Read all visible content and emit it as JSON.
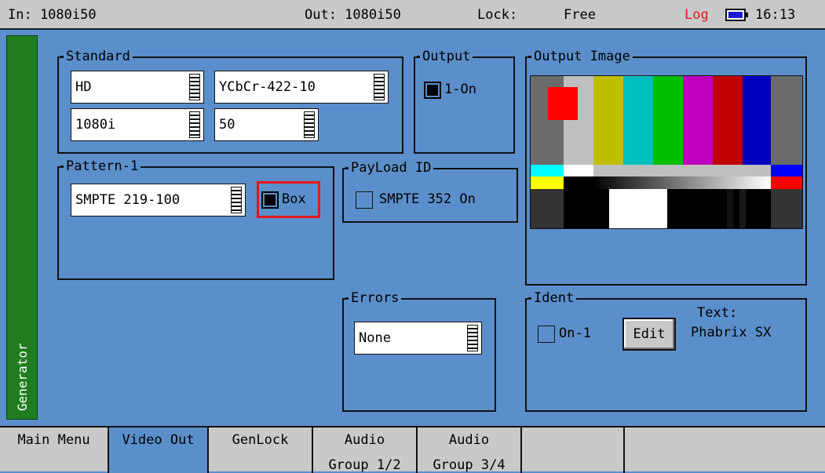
{
  "status": {
    "input": "In: 1080i50",
    "output": "Out: 1080i50",
    "lock_label": "Lock:",
    "lock_value": "Free",
    "log": "Log",
    "time": "16:13"
  },
  "side_label": "Generator",
  "standard": {
    "title": "Standard",
    "fields": [
      "HD",
      "YCbCr-422-10",
      "1080i",
      "50"
    ]
  },
  "output": {
    "title": "Output",
    "checkbox_label": "1-On",
    "checked": true
  },
  "output_image": {
    "title": "Output Image"
  },
  "pattern": {
    "title": "Pattern-1",
    "value": "SMPTE 219-100",
    "box_label": "Box",
    "box_checked": true
  },
  "payload": {
    "title": "PayLoad ID",
    "checkbox_label": "SMPTE 352 On",
    "checked": false
  },
  "errors": {
    "title": "Errors",
    "value": "None"
  },
  "ident": {
    "title": "Ident",
    "checkbox_label": "On-1",
    "checked": false,
    "edit_label": "Edit",
    "text_label": "Text:",
    "text_value": "Phabrix SX"
  },
  "tabs": [
    {
      "l1": "Main Menu",
      "l2": ""
    },
    {
      "l1": "Video Out",
      "l2": ""
    },
    {
      "l1": "GenLock",
      "l2": ""
    },
    {
      "l1": "Audio",
      "l2": "Group 1/2"
    },
    {
      "l1": "Audio",
      "l2": "Group 3/4"
    },
    {
      "l1": "",
      "l2": ""
    },
    {
      "l1": "",
      "l2": ""
    }
  ],
  "colors": {
    "background": "#5b8fcb",
    "status_bar": "#c9c9c9",
    "generator_tab": "#1f7d1f",
    "log_text": "#e8151b",
    "highlight": "#e8151b"
  },
  "icons": {
    "battery": "battery-icon"
  }
}
